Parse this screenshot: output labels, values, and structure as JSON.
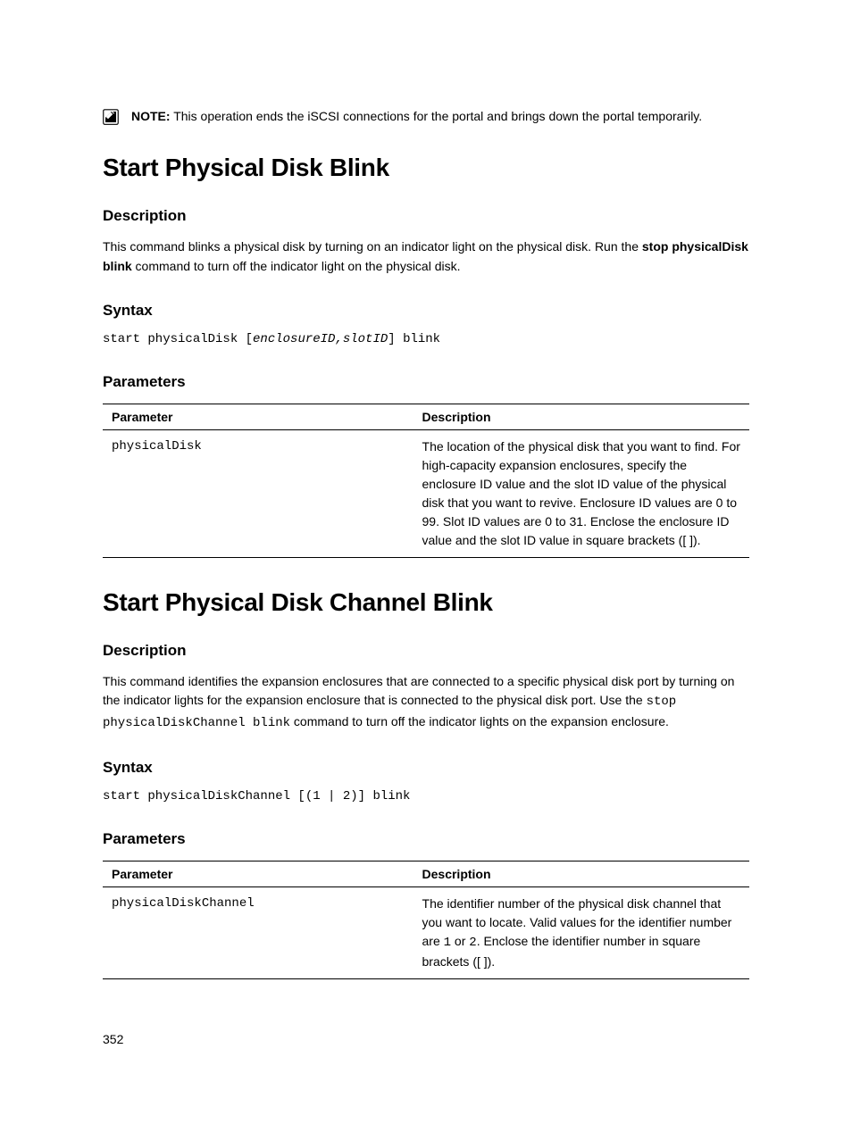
{
  "note": {
    "label": "NOTE:",
    "text": " This operation ends the iSCSI connections for the portal and brings down the portal temporarily."
  },
  "section1": {
    "title": "Start Physical Disk Blink",
    "desc_heading": "Description",
    "desc_pre": "This command blinks a physical disk by turning on an indicator light on the physical disk. Run the ",
    "desc_bold": "stop physicalDisk blink",
    "desc_post": " command to turn off the indicator light on the physical disk.",
    "syntax_heading": "Syntax",
    "syntax_pre": "start physicalDisk [",
    "syntax_italic": "enclosureID,slotID",
    "syntax_post": "] blink",
    "params_heading": "Parameters",
    "table": {
      "h1": "Parameter",
      "h2": "Description",
      "r1c1": "physicalDisk",
      "r1c2": "The location of the physical disk that you want to find. For high-capacity expansion enclosures, specify the enclosure ID value and the slot ID value of the physical disk that you want to revive. Enclosure ID values are 0 to 99. Slot ID values are 0 to 31. Enclose the enclosure ID value and the slot ID value in square brackets ([ ])."
    }
  },
  "section2": {
    "title": "Start Physical Disk Channel Blink",
    "desc_heading": "Description",
    "desc_pre": "This command identifies the expansion enclosures that are connected to a specific physical disk port by turning on the indicator lights for the expansion enclosure that is connected to the physical disk port. Use the ",
    "desc_mono_pre": "stop",
    "desc_br": "",
    "desc_mono_post": "physicalDiskChannel blink",
    "desc_post": " command to turn off the indicator lights on the expansion enclosure.",
    "syntax_heading": "Syntax",
    "syntax": "start physicalDiskChannel [(1 | 2)] blink",
    "params_heading": "Parameters",
    "table": {
      "h1": "Parameter",
      "h2": "Description",
      "r1c1": "physicalDiskChannel",
      "r1c2_pre": "The identifier number of the physical disk channel that you want to locate. Valid values for the identifier number are ",
      "r1c2_m1": "1",
      "r1c2_mid": " or ",
      "r1c2_m2": "2",
      "r1c2_post": ". Enclose the identifier number in square brackets ([ ])."
    }
  },
  "page_number": "352"
}
